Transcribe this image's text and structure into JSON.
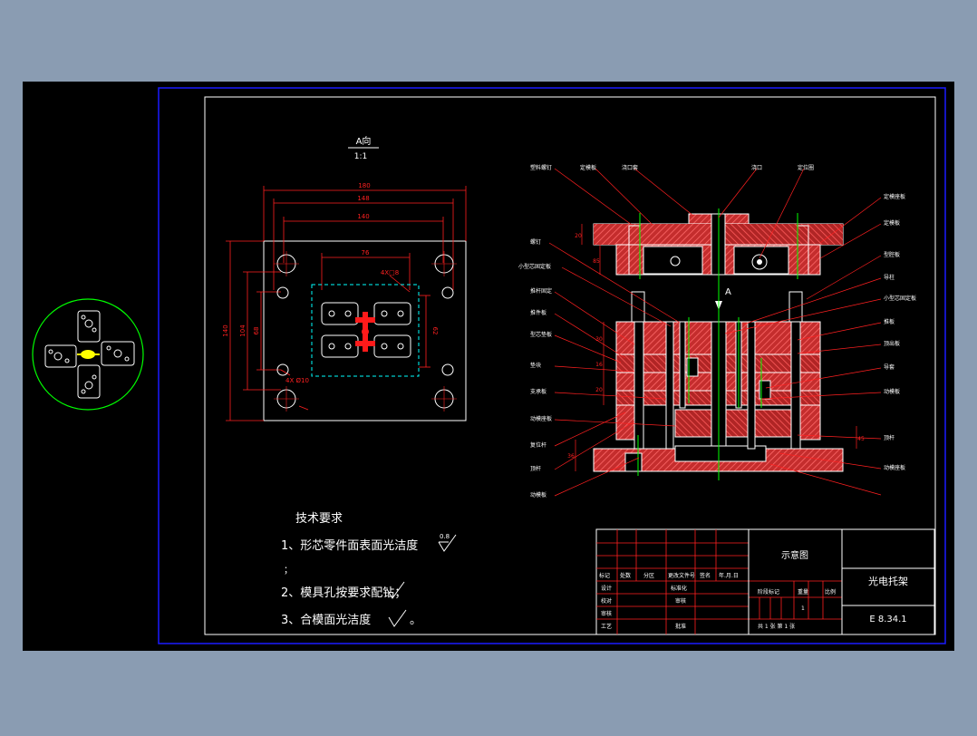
{
  "colors": {
    "background": "#8a9cb2",
    "canvas": "#000000",
    "frame": "#0000ff",
    "line": "#ffffff",
    "dimension": "#ff0000",
    "hatch": "#ff3b3b",
    "centerline": "#00ff00",
    "hidden": "#00ffff"
  },
  "view_a": {
    "title": "A向",
    "scale": "1:1",
    "dims": {
      "w180": "180",
      "w148": "148",
      "w140": "140",
      "w76": "76",
      "h140": "140",
      "h104": "104",
      "h68": "68",
      "h62": "62",
      "hole1": "4X□8",
      "hole2": "4X Ø10"
    }
  },
  "section_labels": {
    "top": [
      "塑料螺钉",
      "定模板",
      "浇口套",
      "浇口",
      "定位圈"
    ],
    "left": [
      "螺钉",
      "小型芯固定板",
      "推杆固定",
      "推件板",
      "型芯垫板",
      "垫块",
      "支承板",
      "动模座板",
      "复位杆",
      "顶杆",
      "动模板"
    ],
    "right": [
      "定模座板",
      "定模板",
      "型腔板",
      "导柱",
      "小型芯固定板",
      "推板",
      "顶出板",
      "导套",
      "动模板",
      "顶杆",
      "动模座板"
    ],
    "arrow": "A"
  },
  "section_dims": [
    "20",
    "85",
    "30",
    "16",
    "20",
    "36",
    "45"
  ],
  "tech": {
    "title": "技术要求",
    "item1": "1、形芯零件面表面光洁度",
    "item1_value": "0.8",
    "item1b": "；",
    "item2": "2、模具孔按要求配钻；",
    "item3": "3、合模面光洁度",
    "item3_end": "。"
  },
  "title_block": {
    "drawing_title": "示意图",
    "name": "光电托架",
    "code": "E 8.34.1",
    "header_cells": [
      "标记",
      "处数",
      "分区",
      "更改文件号",
      "签名",
      "年.月.日"
    ],
    "row_labels": [
      "设计",
      "校对",
      "审核",
      "工艺"
    ],
    "std_label": "标准化",
    "approve_label": "批准",
    "review_label": "审核",
    "stage_label": "阶段标记",
    "weight_label": "重量",
    "ratio_label": "比例",
    "ratio_value": "1",
    "sheet_text": "共 1 张   第 1 张"
  }
}
